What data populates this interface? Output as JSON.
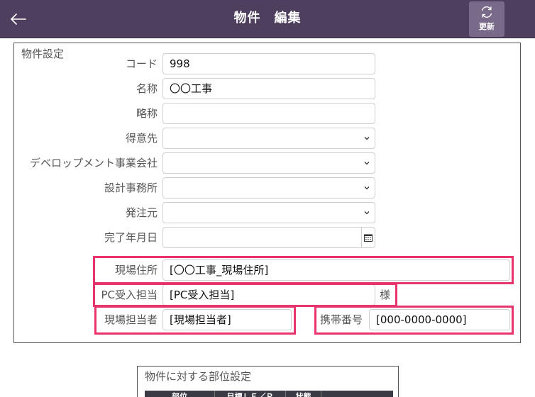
{
  "header": {
    "title": "物件　編集",
    "refresh_label": "更新"
  },
  "section": {
    "title": "物件設定"
  },
  "fields": {
    "code": {
      "label": "コード",
      "value": "998"
    },
    "name": {
      "label": "名称",
      "value": "〇〇工事"
    },
    "short_name": {
      "label": "略称",
      "value": ""
    },
    "customer": {
      "label": "得意先",
      "value": ""
    },
    "developer": {
      "label": "デベロップメント事業会社",
      "value": ""
    },
    "design_office": {
      "label": "設計事務所",
      "value": ""
    },
    "orderer": {
      "label": "発注元",
      "value": ""
    },
    "completion_date": {
      "label": "完了年月日",
      "value": ""
    },
    "site_address": {
      "label": "現場住所",
      "value": "[〇〇工事_現場住所]"
    },
    "pc_receiver": {
      "label": "PC受入担当",
      "value": "[PC受入担当]",
      "suffix": "様"
    },
    "site_manager": {
      "label": "現場担当者",
      "value": "[現場担当者]"
    },
    "mobile_number": {
      "label": "携帯番号",
      "value": "[000-0000-0000]"
    }
  },
  "sub_section": {
    "title": "物件に対する部位設定",
    "columns": [
      "部位",
      "目標ＬＥ／Ｐ",
      "状態",
      ""
    ]
  },
  "colors": {
    "header_bg": "#4f3f5f",
    "refresh_bg": "#7a6a8a",
    "highlight": "#e8336d"
  }
}
